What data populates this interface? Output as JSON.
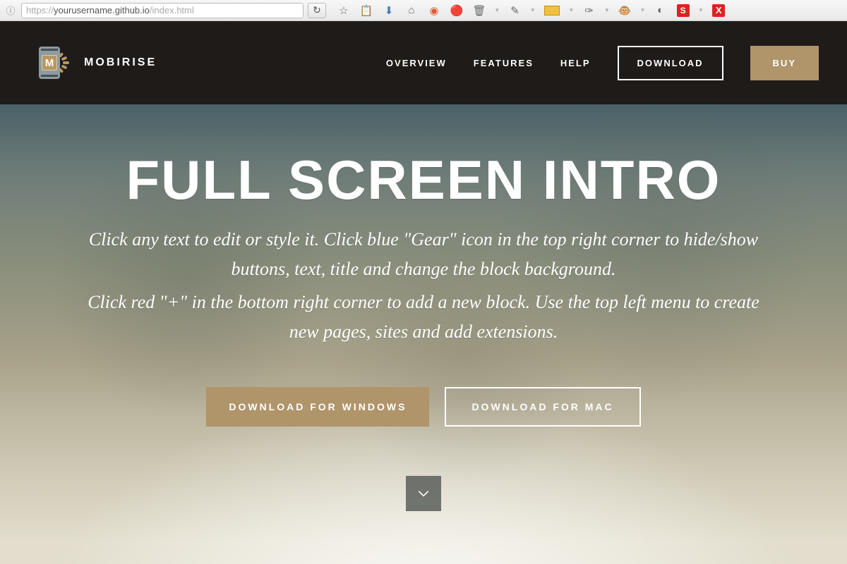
{
  "browser": {
    "url_prefix": "https://",
    "url_host": "yourusername.github.io",
    "url_path": "/index.html"
  },
  "header": {
    "brand": "MOBIRISE",
    "nav": {
      "overview": "OVERVIEW",
      "features": "FEATURES",
      "help": "HELP"
    },
    "download_btn": "DOWNLOAD",
    "buy_btn": "BUY"
  },
  "hero": {
    "title": "FULL SCREEN INTRO",
    "subtitle1": "Click any text to edit or style it. Click blue \"Gear\" icon in the top right corner to hide/show buttons, text, title and change the block background.",
    "subtitle2": "Click red \"+\" in the bottom right corner to add a new block. Use the top left menu to create new pages, sites and add extensions.",
    "btn_windows": "DOWNLOAD FOR WINDOWS",
    "btn_mac": "DOWNLOAD FOR MAC"
  },
  "colors": {
    "accent": "#b0946a",
    "header_bg": "#1f1b18"
  }
}
